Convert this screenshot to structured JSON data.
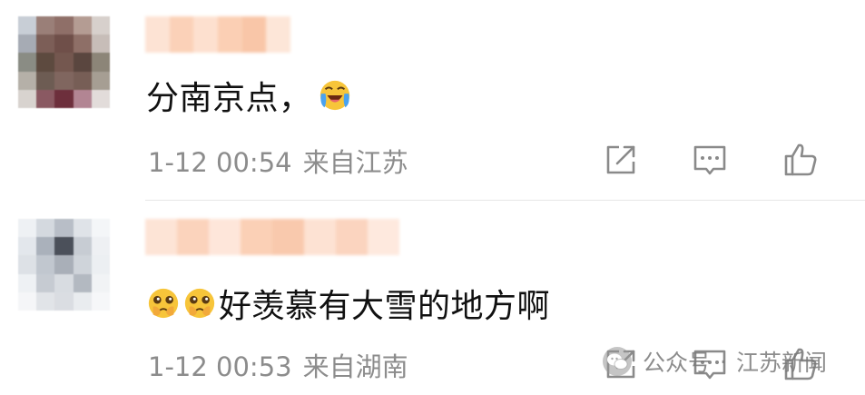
{
  "comments": [
    {
      "content_text": "分南京点，",
      "emoji": "crying-laughing-emoji",
      "timestamp": "1-12 00:54",
      "location": "来自江苏"
    },
    {
      "emojis": [
        "pleading-face-emoji",
        "pleading-face-emoji"
      ],
      "content_text": "好羡慕有大雪的地方啊",
      "timestamp": "1-12 00:53",
      "location": "来自湖南"
    }
  ],
  "actions": {
    "share_icon": "share-icon",
    "comment_icon": "comment-icon",
    "like_icon": "thumbs-up-icon"
  },
  "watermark": {
    "account_type": "公众号",
    "separator": "·",
    "account_name": "江苏新闻"
  },
  "colors": {
    "text": "#111111",
    "meta": "#8c8c8c",
    "icon": "#8a8a8a",
    "divider": "#e6e6e6",
    "emoji_yellow": "#f7c53a",
    "emoji_tear": "#4aa3f0"
  }
}
